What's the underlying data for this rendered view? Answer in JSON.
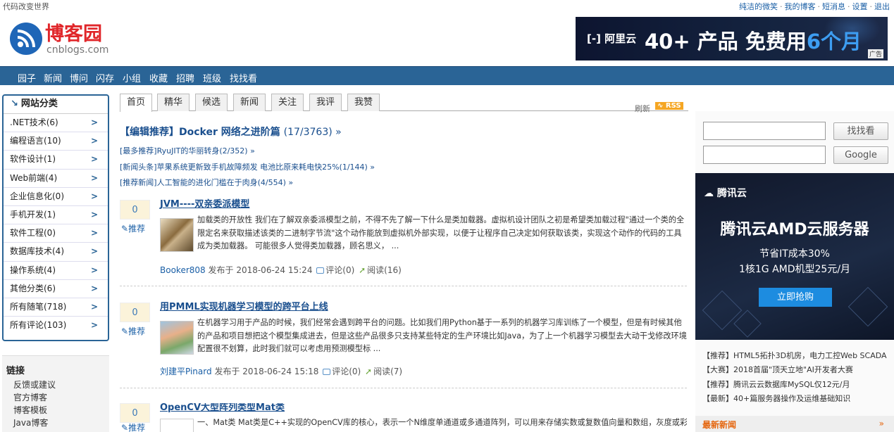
{
  "topbar": {
    "slogan": "代码改变世界",
    "links": [
      "纯洁的微笑",
      "我的博客",
      "短消息",
      "设置",
      "退出"
    ]
  },
  "logo": {
    "name": "博客园",
    "domain": "cnblogs.com"
  },
  "ad_top": {
    "brand": "阿里云",
    "headline_prefix": "40+ 产品 免费用",
    "headline_accent": "6个月",
    "tag": "广告"
  },
  "nav": [
    "园子",
    "新闻",
    "博问",
    "闪存",
    "小组",
    "收藏",
    "招聘",
    "班级",
    "找找看"
  ],
  "categories": {
    "title": "网站分类",
    "items": [
      ".NET技术(6)",
      "编程语言(10)",
      "软件设计(1)",
      "Web前端(4)",
      "企业信息化(0)",
      "手机开发(1)",
      "软件工程(0)",
      "数据库技术(4)",
      "操作系统(4)",
      "其他分类(6)",
      "所有随笔(718)",
      "所有评论(103)"
    ]
  },
  "links": {
    "title": "链接",
    "items": [
      "反馈或建议",
      "官方博客",
      "博客模板",
      "Java博客"
    ]
  },
  "tabs": [
    "首页",
    "精华",
    "候选",
    "新闻",
    "关注",
    "我评",
    "我赞"
  ],
  "refresh": "刷新",
  "rss": "RSS",
  "picks": {
    "main": "【编辑推荐】Docker 网络之进阶篇",
    "main_count": "(17/3763) »",
    "items": [
      "[最多推荐]RyuJIT的华丽转身(2/352) »",
      "[新闻头条]苹果系统更新致手机故障频发 电池比原来耗电快25%(1/144) »",
      "[推荐新闻]人工智能的进化门槛在于肉身(4/554) »"
    ]
  },
  "posts": [
    {
      "votes": "0",
      "recommend": "推荐",
      "title": "JVM----双亲委派模型",
      "summary": "加载类的开放性 我们在了解双亲委派模型之前，不得不先了解一下什么是类加载器。虚拟机设计团队之初是希望类加载过程\"通过一个类的全限定名来获取描述该类的二进制字节流\"这个动作能放到虚拟机外部实现，以便于让程序自己决定如何获取该类，实现这个动作的代码的工具成为类加载器。 可能很多人觉得类加载器，顾名思义， ...",
      "author": "Booker808",
      "posted": "发布于 2018-06-24 15:24",
      "comments": "评论(0)",
      "reads": "阅读(16)"
    },
    {
      "votes": "0",
      "recommend": "推荐",
      "title": "用PMML实现机器学习模型的跨平台上线",
      "summary": "在机器学习用于产品的时候，我们经常会遇到跨平台的问题。比如我们用Python基于一系列的机器学习库训练了一个模型，但是有时候其他的产品和项目想把这个模型集成进去，但是这些产品很多只支持某些特定的生产环境比如Java，为了上一个机器学习模型去大动干戈修改环境配置很不划算，此时我们就可以考虑用预测模型标 ...",
      "author": "刘建平Pinard",
      "posted": "发布于 2018-06-24 15:18",
      "comments": "评论(0)",
      "reads": "阅读(7)"
    },
    {
      "votes": "0",
      "recommend": "推荐",
      "title": "OpenCV大型阵列类型Mat类",
      "summary": "一、Mat类 Mat类是C++实现的OpenCV库的核心，表示一个N维度单通道或多通道阵列，可以用来存储实数或复数值向量和数组，灰度或彩"
    }
  ],
  "search": {
    "button1": "找找看",
    "button2": "Google"
  },
  "ad_side": {
    "brand": "腾讯云",
    "headline": "腾讯云AMD云服务器",
    "line1": "节省IT成本30%",
    "line2": "1核1G AMD机型25元/月",
    "button": "立即抢购"
  },
  "promos": [
    "【推荐】HTML5拓扑3D机房，电力工控Web SCADA",
    "【大赛】2018首届\"顶天立地\"AI开发者大赛",
    "【推荐】腾讯云云数据库MySQL仅12元/月",
    "【最新】40+篇服务器操作及运维基础知识"
  ],
  "news": {
    "title": "最新新闻",
    "more": "»"
  },
  "colors": {
    "nav": "#2a6496",
    "logo_red": "#e0262a",
    "link_blue": "#1a4f8e",
    "news_orange": "#e5650d"
  }
}
